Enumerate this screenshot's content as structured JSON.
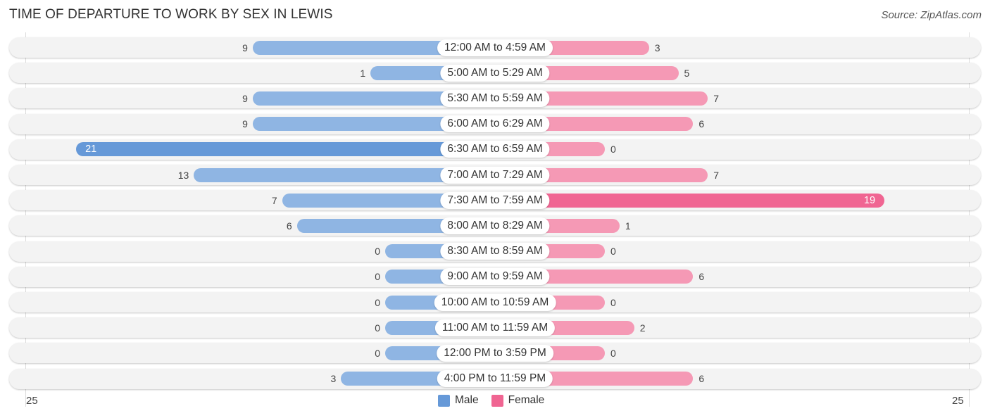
{
  "title": "TIME OF DEPARTURE TO WORK BY SEX IN LEWIS",
  "source": "Source: ZipAtlas.com",
  "colors": {
    "male": "#8fb5e3",
    "male_highlight": "#6699d8",
    "female": "#f599b5",
    "female_highlight": "#f06592"
  },
  "chart_data": {
    "type": "bar",
    "orientation": "horizontal-diverging",
    "title": "TIME OF DEPARTURE TO WORK BY SEX IN LEWIS",
    "categories": [
      "12:00 AM to 4:59 AM",
      "5:00 AM to 5:29 AM",
      "5:30 AM to 5:59 AM",
      "6:00 AM to 6:29 AM",
      "6:30 AM to 6:59 AM",
      "7:00 AM to 7:29 AM",
      "7:30 AM to 7:59 AM",
      "8:00 AM to 8:29 AM",
      "8:30 AM to 8:59 AM",
      "9:00 AM to 9:59 AM",
      "10:00 AM to 10:59 AM",
      "11:00 AM to 11:59 AM",
      "12:00 PM to 3:59 PM",
      "4:00 PM to 11:59 PM"
    ],
    "series": [
      {
        "name": "Male",
        "values": [
          9,
          1,
          9,
          9,
          21,
          13,
          7,
          6,
          0,
          0,
          0,
          0,
          0,
          3
        ]
      },
      {
        "name": "Female",
        "values": [
          3,
          5,
          7,
          6,
          0,
          7,
          19,
          1,
          0,
          6,
          0,
          2,
          0,
          6
        ]
      }
    ],
    "axis": {
      "left_label": "25",
      "right_label": "25",
      "xlim": [
        -25,
        25
      ]
    },
    "legend": {
      "position": "bottom-center",
      "entries": [
        "Male",
        "Female"
      ]
    },
    "grid": false
  }
}
